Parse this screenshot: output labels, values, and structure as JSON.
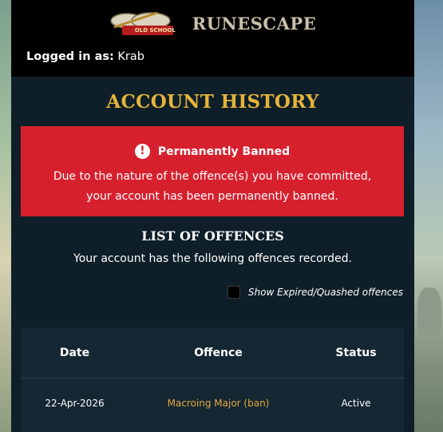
{
  "header": {
    "osrs_logo_text": "OLD SCHOOL",
    "brand_name": "RUNESCAPE",
    "logged_in_label": "Logged in as:",
    "username": "Krab"
  },
  "page": {
    "title": "ACCOUNT HISTORY"
  },
  "alert": {
    "icon": "exclamation-icon",
    "heading": "Permanently Banned",
    "line1": "Due to the nature of the offence(s) you have committed,",
    "line2": "your account has been permanently banned."
  },
  "offences": {
    "title": "LIST OF OFFENCES",
    "subtitle": "Your account has the following offences recorded.",
    "show_expired_label": "Show Expired/Quashed offences",
    "show_expired_checked": false,
    "columns": [
      "Date",
      "Offence",
      "Status"
    ],
    "rows": [
      {
        "date": "22-Apr-2026",
        "offence": "Macroing Major (ban)",
        "status": "Active"
      }
    ]
  },
  "colors": {
    "accent_gold": "#e5b43b",
    "alert_red": "#d7202e",
    "panel_bg": "#0f1f29"
  }
}
